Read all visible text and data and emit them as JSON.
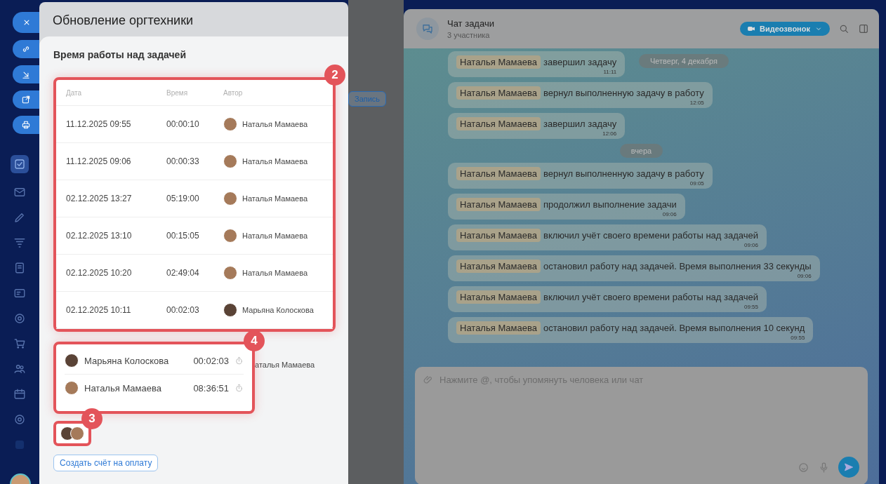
{
  "modal": {
    "title": "Обновление оргтехники",
    "section_title": "Время работы над задачей",
    "table": {
      "callout": "2",
      "columns": [
        "Дата",
        "Время",
        "Автор"
      ],
      "rows": [
        {
          "date": "11.12.2025 09:55",
          "time": "00:00:10",
          "author": "Наталья Мамаева"
        },
        {
          "date": "11.12.2025 09:06",
          "time": "00:00:33",
          "author": "Наталья Мамаева"
        },
        {
          "date": "02.12.2025 13:27",
          "time": "05:19:00",
          "author": "Наталья Мамаева"
        },
        {
          "date": "02.12.2025 13:10",
          "time": "00:15:05",
          "author": "Наталья Мамаева"
        },
        {
          "date": "02.12.2025 10:20",
          "time": "02:49:04",
          "author": "Наталья Мамаева"
        },
        {
          "date": "02.12.2025 10:11",
          "time": "00:02:03",
          "author": "Марьяна Колоскова"
        }
      ]
    },
    "summary": {
      "callout": "4",
      "rows": [
        {
          "name": "Марьяна Колоскова",
          "time": "00:02:03"
        },
        {
          "name": "Наталья Мамаева",
          "time": "08:36:51"
        }
      ]
    },
    "background_author": "аталья Мамаева",
    "participants_callout": "3",
    "invoice_button": "Создать счёт на оплату"
  },
  "background_panel": {
    "button": "Запись"
  },
  "chat": {
    "title": "Чат задачи",
    "subtitle": "3 участника",
    "call_button": "Видеозвонок",
    "sticky_date": "Четверг, 4 декабря",
    "items": [
      {
        "kind": "message",
        "name": "Наталья Мамаева",
        "text": "завершил задачу",
        "time": "11:11"
      },
      {
        "kind": "message",
        "name": "Наталья Мамаева",
        "text": "вернул выполненную задачу в работу",
        "time": "12:05"
      },
      {
        "kind": "message",
        "name": "Наталья Мамаева",
        "text": "завершил задачу",
        "time": "12:06"
      },
      {
        "kind": "date",
        "text": "вчера"
      },
      {
        "kind": "message",
        "name": "Наталья Мамаева",
        "text": "вернул выполненную задачу в работу",
        "time": "09:05"
      },
      {
        "kind": "message",
        "name": "Наталья Мамаева",
        "text": "продолжил выполнение задачи",
        "time": "09:06"
      },
      {
        "kind": "message",
        "name": "Наталья Мамаева",
        "text": "включил учёт своего времени работы над задачей",
        "time": "09:06"
      },
      {
        "kind": "message",
        "name": "Наталья Мамаева",
        "text": "остановил работу над задачей. Время выполнения 33 секунды",
        "time": "09:06"
      },
      {
        "kind": "message",
        "name": "Наталья Мамаева",
        "text": "включил учёт своего времени работы над задачей",
        "time": "09:55"
      },
      {
        "kind": "message",
        "name": "Наталья Мамаева",
        "text": "остановил работу над задачей. Время выполнения 10 секунд",
        "time": "09:55"
      }
    ],
    "input": {
      "placeholder": "Нажмите @, чтобы упомянуть человека или чат"
    }
  }
}
